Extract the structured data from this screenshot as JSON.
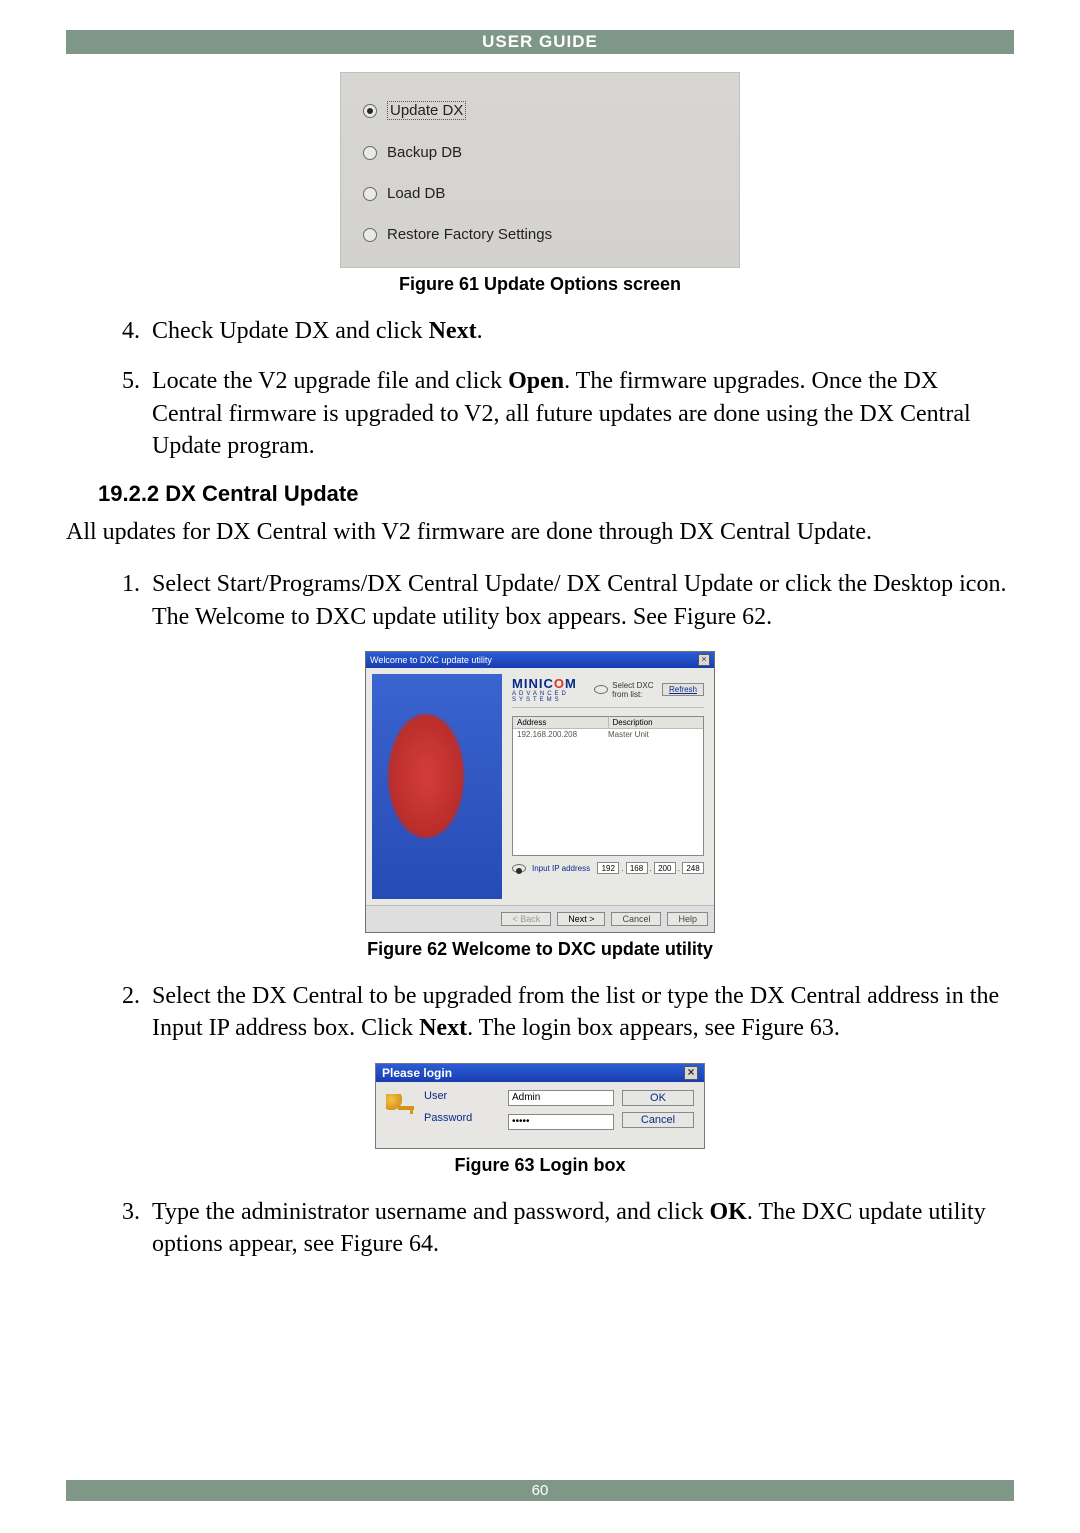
{
  "header": {
    "title": "USER GUIDE"
  },
  "footer": {
    "page_number": "60"
  },
  "fig61": {
    "options": [
      {
        "label": "Update DX",
        "selected": true,
        "focused": true
      },
      {
        "label": "Backup DB",
        "selected": false,
        "focused": false
      },
      {
        "label": "Load DB",
        "selected": false,
        "focused": false
      },
      {
        "label": "Restore Factory Settings",
        "selected": false,
        "focused": false
      }
    ],
    "caption": "Figure 61 Update Options screen"
  },
  "steps_a": {
    "item4_pre": "Check Update DX and click ",
    "item4_bold": "Next",
    "item4_post": ".",
    "item5_pre": "Locate the V2 upgrade file and click ",
    "item5_bold": "Open",
    "item5_post": ". The firmware upgrades. Once the DX Central firmware is upgraded to V2, all future updates are done using the DX Central Update program."
  },
  "section": {
    "heading": "19.2.2 DX Central Update",
    "intro": "All updates for DX Central with V2 firmware are done through DX Central Update."
  },
  "steps_b": {
    "item1": "Select Start/Programs/DX Central Update/ DX Central Update or click the Desktop icon. The Welcome to DXC update utility box appears. See Figure 62.",
    "item2_pre": "Select the DX Central to be upgraded from the list or type the DX Central address in the Input IP address box. Click ",
    "item2_bold": "Next",
    "item2_post": ". The login box appears, see Figure 63.",
    "item3_pre": "Type the administrator username and password, and click ",
    "item3_bold": "OK",
    "item3_post": ". The DXC update utility options appear, see Figure 64."
  },
  "fig62": {
    "title": "Welcome to DXC update utility",
    "brand": "MINIC",
    "brand_red": "O",
    "brand2": "M",
    "brand_sub": "ADVANCED SYSTEMS",
    "select_label": "Select DXC from list:",
    "refresh": "Refresh",
    "cols": {
      "c1": "Address",
      "c2": "Description"
    },
    "row": {
      "c1": "192.168.200.208",
      "c2": "Master Unit"
    },
    "ip_label": "Input IP address",
    "ip": {
      "o1": "192",
      "o2": "168",
      "o3": "200",
      "o4": "248"
    },
    "btn_back": "< Back",
    "btn_next": "Next >",
    "btn_cancel": "Cancel",
    "btn_help": "Help",
    "caption": "Figure 62 Welcome to DXC update utility"
  },
  "fig63": {
    "title": "Please login",
    "user_label": "User",
    "pass_label": "Password",
    "user_value": "Admin",
    "pass_value": "*****",
    "btn_ok": "OK",
    "btn_cancel": "Cancel",
    "caption": "Figure 63 Login box"
  }
}
